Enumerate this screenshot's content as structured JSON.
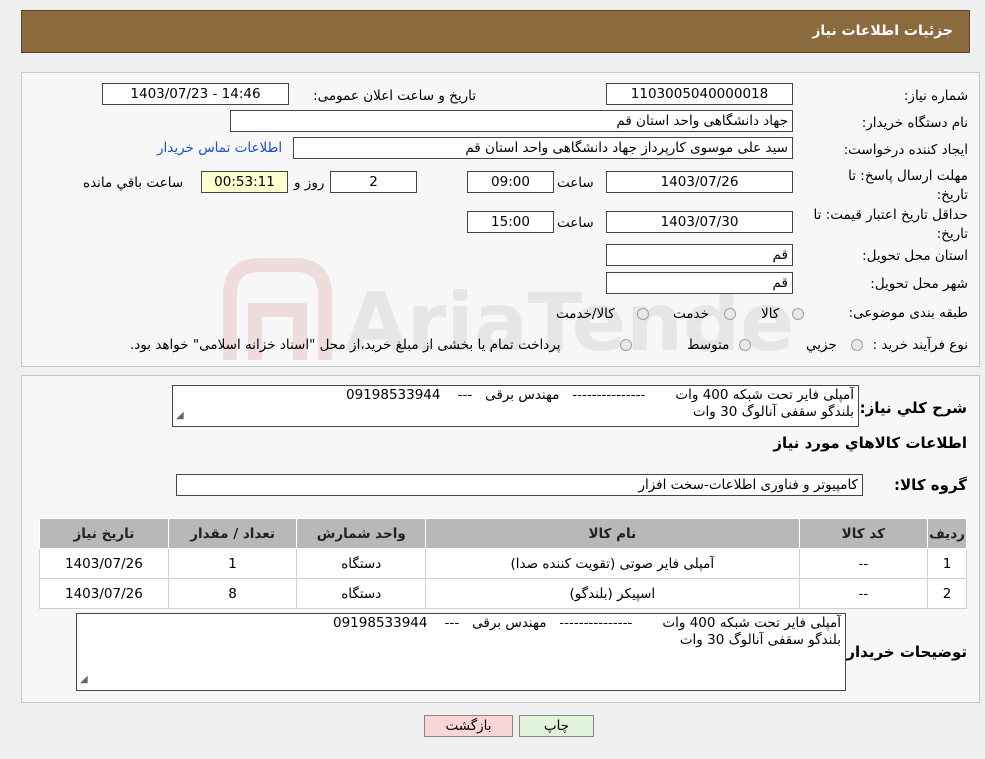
{
  "header": {
    "title": "جزئیات اطلاعات نیاز"
  },
  "watermark": {
    "text": "AriaTender.neT"
  },
  "form": {
    "need_number_label": "شماره نیاز:",
    "need_number": "1103005040000018",
    "announce_label": "تاریخ و ساعت اعلان عمومی:",
    "announce_value": "1403/07/23 - 14:46",
    "buyer_org_label": "نام دستگاه خریدار:",
    "buyer_org": "جهاد دانشگاهی واحد استان قم",
    "creator_label": "ایجاد کننده درخواست:",
    "creator": "سید علی موسوی کارپرداز جهاد دانشگاهی واحد استان قم",
    "contact_link": "اطلاعات تماس خریدار",
    "deadline_label": "مهلت ارسال پاسخ: تا تاریخ:",
    "deadline_date": "1403/07/26",
    "time_label": "ساعت",
    "deadline_time": "09:00",
    "days_value": "2",
    "days_label": "روز و",
    "remaining_time": "00:53:11",
    "remaining_label": "ساعت باقي مانده",
    "validity_label": "حداقل تاریخ اعتبار قیمت: تا تاریخ:",
    "validity_date": "1403/07/30",
    "validity_time": "15:00",
    "province_label": "استان محل تحویل:",
    "province": "قم",
    "city_label": "شهر محل تحویل:",
    "city": "قم",
    "category_label": "طبقه بندی موضوعی:",
    "category_options": [
      "کالا",
      "خدمت",
      "کالا/خدمت"
    ],
    "process_label": "نوع فرآیند خرید :",
    "process_options": [
      "جزیي",
      "متوسط"
    ],
    "process_note": "پرداخت تمام یا بخشی از مبلغ خرید،از محل \"اسناد خزانه اسلامی\" خواهد بود."
  },
  "description": {
    "label": "شرح کلي نياز:",
    "line1": "آمپلی فایر تحت شبکه 400 وات       ---------------   مهندس برقی   ---    09198533944",
    "line2": "بلندگو سقفی آنالوگ 30 وات"
  },
  "goods": {
    "title": "اطلاعات کالاهاي مورد نياز",
    "group_label": "گروه کالا:",
    "group_value": "کامپیوتر و فناوری اطلاعات-سخت افزار"
  },
  "table": {
    "headers": [
      "رديف",
      "کد کالا",
      "نام کالا",
      "واحد شمارش",
      "تعداد / مقدار",
      "تاریخ نیاز"
    ],
    "rows": [
      [
        "1",
        "--",
        "آمپلی فایر صوتی (تقویت کننده صدا)",
        "دستگاه",
        "1",
        "1403/07/26"
      ],
      [
        "2",
        "--",
        "اسپیکر (بلندگو)",
        "دستگاه",
        "8",
        "1403/07/26"
      ]
    ]
  },
  "buyer_notes": {
    "label": "توضیحات خریدار:",
    "line1": "آمپلی فایر تحت شبکه 400 وات       ---------------   مهندس برقی   ---    09198533944",
    "line2": "بلندگو سقفی آنالوگ 30 وات"
  },
  "buttons": {
    "print": "چاپ",
    "back": "بازگشت"
  },
  "colors": {
    "header": "#8b6a3e",
    "back_button": "#f8d6d6",
    "print_button": "#e2f3dc",
    "link": "#1e4fc8"
  }
}
